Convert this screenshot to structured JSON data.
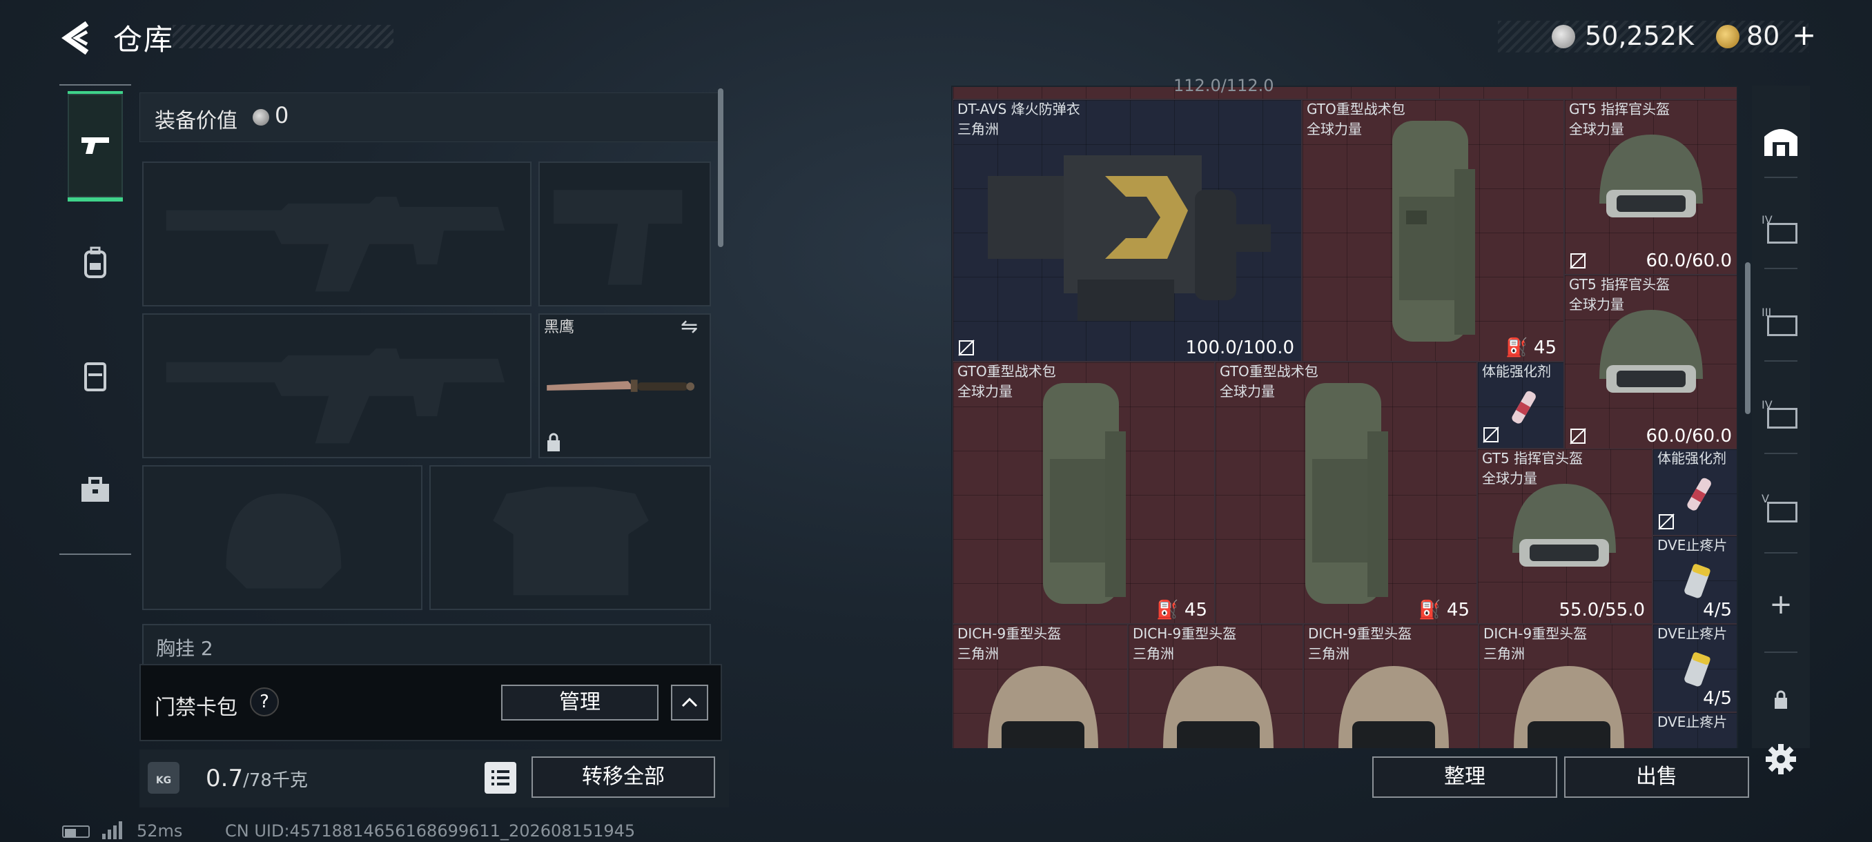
{
  "header": {
    "title": "仓库",
    "money": "50,252K",
    "coupons": "80",
    "add_label": "+"
  },
  "left_nav": {
    "items": [
      "gun-icon",
      "backpack-icon",
      "vest-icon",
      "case-icon"
    ]
  },
  "loadout": {
    "value_label": "装备价值",
    "value": "0",
    "knife_name": "黑鹰",
    "chest_label": "胸挂",
    "chest_count": "2"
  },
  "keycard": {
    "label": "门禁卡包",
    "help": "?",
    "manage": "管理"
  },
  "weight": {
    "current": "0.7",
    "unit": "/78千克",
    "transfer": "转移全部",
    "kg_badge": "KG"
  },
  "status": {
    "ping": "52ms",
    "uid": "CN UID:4571881465616869961​1_202608151945"
  },
  "storage": {
    "top_text": "112.0/112.0",
    "top_text2": "100.0/100.0",
    "items": [
      {
        "name": "DT-AVS 烽火防弹衣",
        "sub": "三角洲",
        "value": "100.0/100.0"
      },
      {
        "name": "GTO重型战术包",
        "sub": "全球力量",
        "value": "45"
      },
      {
        "name": "GT5 指挥官头盔",
        "sub": "全球力量",
        "value": "60.0/60.0"
      },
      {
        "name": "GT5 指挥官头盔",
        "sub": "全球力量",
        "value": "60.0/60.0"
      },
      {
        "name": "GTO重型战术包",
        "sub": "全球力量",
        "value": "45"
      },
      {
        "name": "GTO重型战术包",
        "sub": "全球力量",
        "value": "45"
      },
      {
        "name": "体能强化剂",
        "sub": "",
        "value": ""
      },
      {
        "name": "GT5 指挥官头盔",
        "sub": "全球力量",
        "value": "55.0/55.0"
      },
      {
        "name": "体能强化剂",
        "sub": "",
        "value": ""
      },
      {
        "name": "DVE止疼片",
        "sub": "",
        "value": "4/5"
      },
      {
        "name": "DICH-9重型头盔",
        "sub": "三角洲",
        "value": ""
      },
      {
        "name": "DICH-9重型头盔",
        "sub": "三角洲",
        "value": ""
      },
      {
        "name": "DICH-9重型头盔",
        "sub": "三角洲",
        "value": ""
      },
      {
        "name": "DICH-9重型头盔",
        "sub": "三角洲",
        "value": ""
      },
      {
        "name": "DVE止疼片",
        "sub": "",
        "value": "4/5"
      },
      {
        "name": "DVE止疼片",
        "sub": "",
        "value": ""
      }
    ]
  },
  "right_bar": {
    "tabs": [
      "IV",
      "III",
      "IV",
      "V"
    ],
    "add": "+"
  },
  "buttons": {
    "sort": "整理",
    "sell": "出售"
  },
  "colors": {
    "accent_green": "#3fd38a",
    "cell_red": "#4a2a30",
    "cell_blue": "#22283a"
  }
}
